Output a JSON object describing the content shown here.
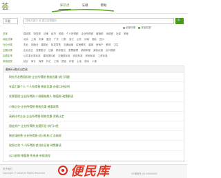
{
  "header": {
    "logo_glyph": "荟",
    "nav": [
      "知识点",
      "法规",
      "帮助"
    ]
  },
  "search": {
    "select_label": "全部",
    "select_value": "不限",
    "placeholder": "搜索关键字 或 提交您想要的",
    "button_glyph": "🔍",
    "options": [
      "全部分类",
      "完全匹配"
    ]
  },
  "categories": [
    {
      "head": "总体",
      "items": [
        "建设类",
        "财务类",
        "法律",
        "经济",
        "税费",
        "个人所得税",
        "企业所得税",
        "增值税",
        "消费税",
        "社保",
        "其他"
      ]
    },
    {
      "head": "地区法律",
      "items": [
        "北京",
        "上海",
        "天津",
        "重庆",
        "广东",
        "江苏",
        "浙江",
        "山东",
        "河南",
        "湖北",
        "四川"
      ]
    },
    {
      "head": "行业分类",
      "items": [
        "农业",
        "制造业",
        "建筑业",
        "批发零售",
        "交通运输",
        "住宿餐饮",
        "金融",
        "房地产",
        "教育",
        "卫生"
      ]
    },
    {
      "head": "主题分类",
      "items": [
        "企业设立",
        "变更登记",
        "注销",
        "税务登记",
        "发票管理",
        "纳税申报",
        "减免优惠",
        "出口退税"
      ]
    },
    {
      "head": "定额定率",
      "items": [
        "公共事业类标准",
        "建设类标准",
        "交通类标准",
        "收费标准",
        "其他标准",
        "工资标准"
      ]
    },
    {
      "head": "其他相关",
      "items": [
        "统计",
        "审计",
        "海关",
        "外汇",
        "工商",
        "质检",
        "环保",
        "土地",
        "劳动",
        "人事"
      ]
    }
  ],
  "panel": {
    "title": "最新行政执法信息",
    "items": [
      "研究开发费用扣除·企业所得税·税收优惠·执行问题",
      "年度汇算个人·个人所得税·税收优惠·办理口径说明",
      "发票管理·企业所得税·小规模纳税人·增值税·政策解读",
      "小微企业·企业所得税·税收优惠·普惠政策",
      "高新技术企业·企业所得税·税收优惠·资格认定",
      "固定资产·企业所得税·加速折旧·执行口径",
      "跨区域经营·企业所得税·总分机构·汇总纳税",
      "股息红利·个人所得税·差别化征收·政策解读",
      "出口退税·增值税·免抵退·申报流程"
    ]
  },
  "footer": {
    "links": "关于我们",
    "copyright": "Copyright © 2018 All Rights Reserved",
    "beian": "ICP备案号 (0) 00000000"
  },
  "watermark": {
    "text": "便民库"
  }
}
